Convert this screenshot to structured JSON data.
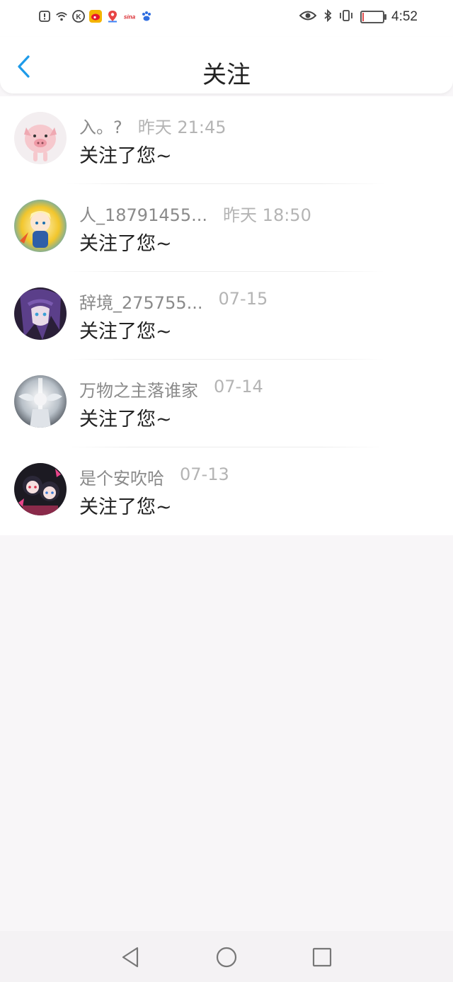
{
  "status_bar": {
    "time": "4:52",
    "left_icons": [
      "alert-icon",
      "wifi-icon",
      "k-app-icon",
      "weibo-app-icon",
      "map-app-icon",
      "sina-app-icon",
      "baidu-app-icon"
    ],
    "right_icons": [
      "eye-icon",
      "bluetooth-icon",
      "vibrate-icon",
      "battery-icon"
    ],
    "battery_level": 0.05,
    "k_label": "K",
    "sina_label": "sina"
  },
  "header": {
    "title": "关注",
    "back_icon": "chevron-left-icon",
    "accent_color": "#1e9be9"
  },
  "notifications": [
    {
      "name": "入。?",
      "time": "昨天 21:45",
      "message": "关注了您~"
    },
    {
      "name": "人_18791455...",
      "time": "昨天 18:50",
      "message": "关注了您~"
    },
    {
      "name": "辞境_275755...",
      "time": "07-15",
      "message": "关注了您~"
    },
    {
      "name": "万物之主落谁家",
      "time": "07-14",
      "message": "关注了您~"
    },
    {
      "name": "是个安吹哈",
      "time": "07-13",
      "message": "关注了您~"
    }
  ],
  "nav_bar": {
    "buttons": [
      "back-triangle-icon",
      "home-circle-icon",
      "recents-square-icon"
    ]
  }
}
